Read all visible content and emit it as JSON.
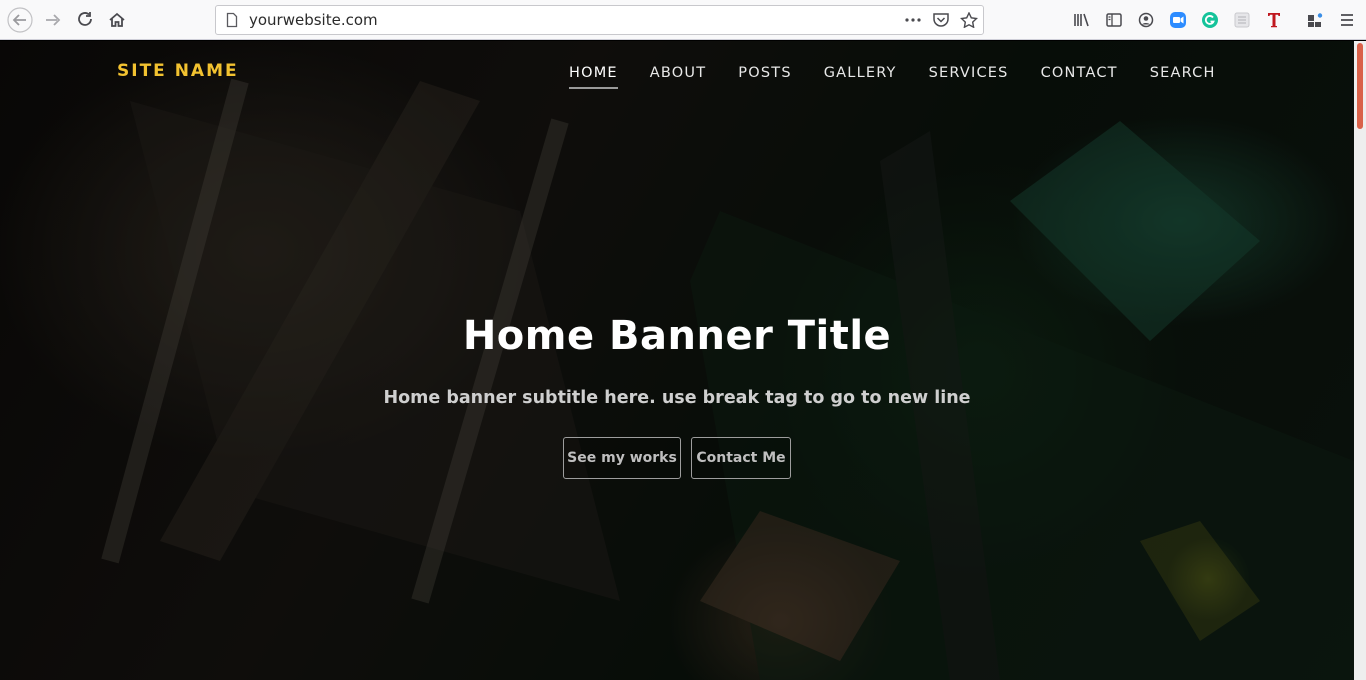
{
  "browser": {
    "url": "yourwebsite.com",
    "icons": [
      "back-icon",
      "forward-icon",
      "reload-icon",
      "home-icon",
      "page-icon",
      "more-actions-icon",
      "pocket-icon",
      "bookmark-star-icon",
      "library-icon",
      "sidebar-icon",
      "account-icon",
      "zoom-extension-icon",
      "grammarly-extension-icon",
      "extension-icon",
      "t-extension-icon",
      "extensions-puzzle-icon",
      "menu-icon"
    ]
  },
  "site": {
    "name": "SITE NAME",
    "nav": {
      "home": "HOME",
      "about": "ABOUT",
      "posts": "POSTS",
      "gallery": "GALLERY",
      "services": "SERVICES",
      "contact": "CONTACT",
      "search": "SEARCH"
    },
    "hero": {
      "title": "Home Banner Title",
      "subtitle": "Home banner subtitle here. use break tag to go to new line",
      "primary_button": "See my works",
      "secondary_button": "Contact Me"
    }
  },
  "colors": {
    "site_name": "#f2c230",
    "scroll_thumb": "#d9624a",
    "zoom_blue": "#2d8cff",
    "grammarly_green": "#15c39a",
    "t_red": "#c0181f"
  }
}
